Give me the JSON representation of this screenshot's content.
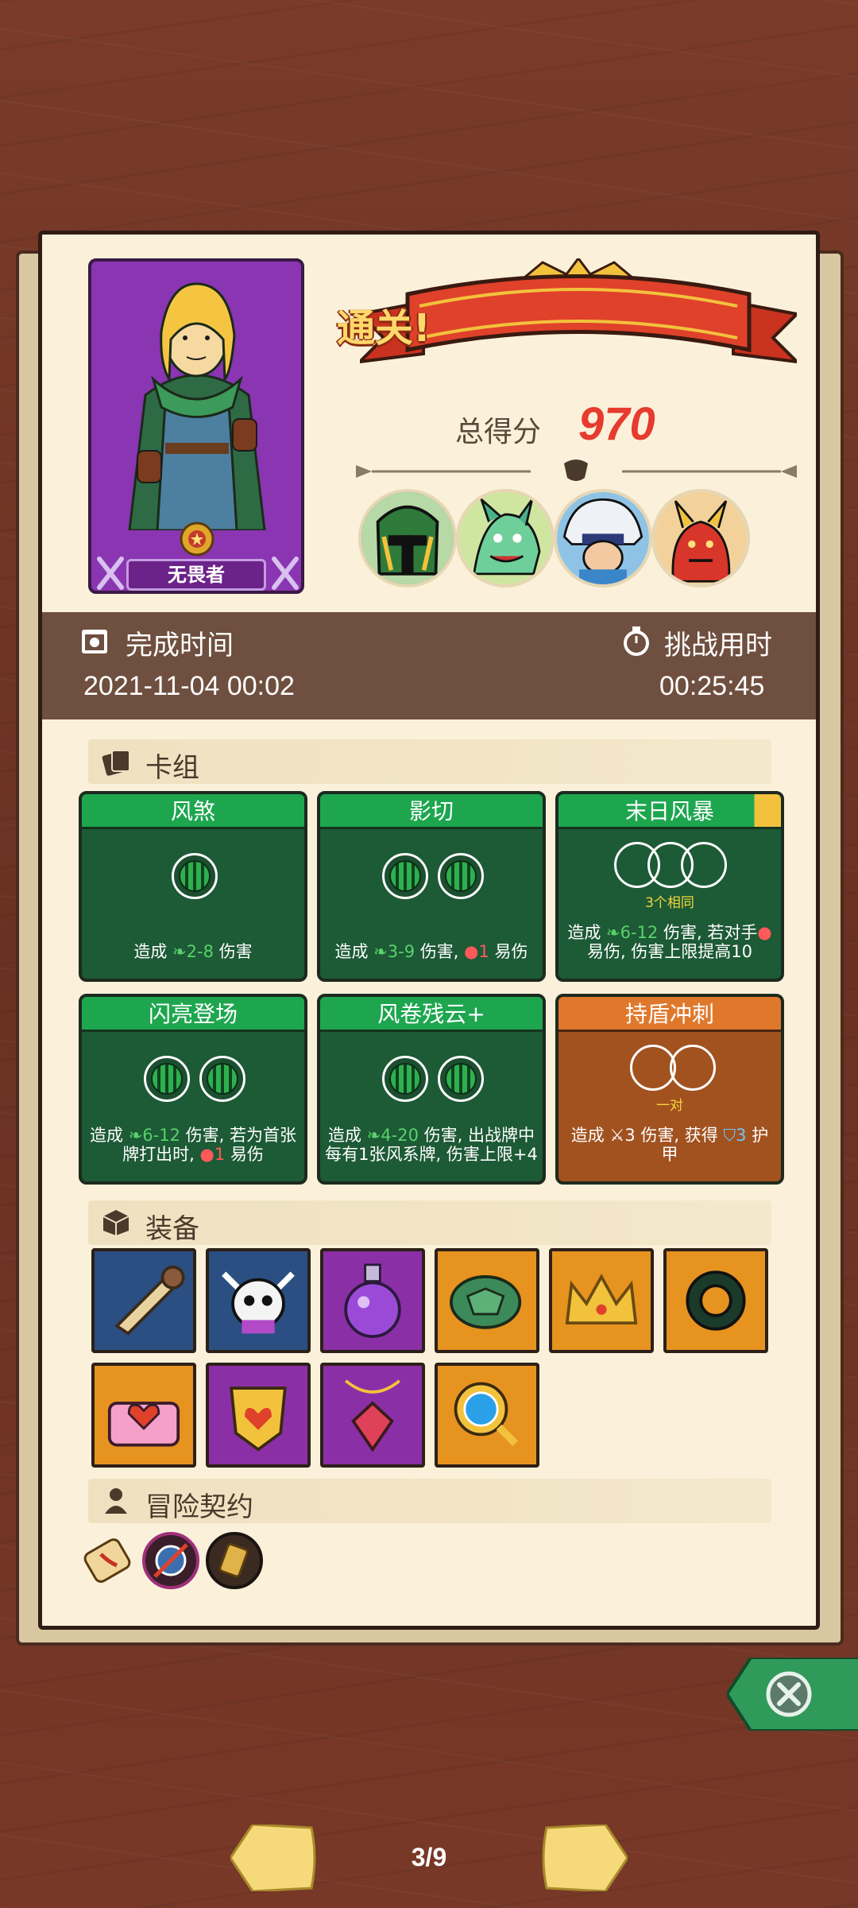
{
  "hero": {
    "title": "无畏者"
  },
  "result": {
    "banner": "通关!",
    "score_label": "总得分",
    "score_value": "970"
  },
  "bosses": [
    "green-helmet-boss-icon",
    "dragon-boss-icon",
    "yeti-boss-icon",
    "red-demon-boss-icon"
  ],
  "time": {
    "finish_label": "完成时间",
    "finish_value": "2021-11-04 00:02",
    "duration_label": "挑战用时",
    "duration_value": "00:25:45"
  },
  "deck": {
    "header": "卡组",
    "cards": [
      {
        "name": "风煞",
        "sub": "",
        "desc": [
          "造成 ",
          {
            "g": "2-8"
          },
          " 伤害"
        ]
      },
      {
        "name": "影切",
        "sub": "",
        "desc": [
          "造成 ",
          {
            "g": "3-9"
          },
          " 伤害, ",
          {
            "r": "1"
          },
          " 易伤"
        ]
      },
      {
        "name": "末日风暴",
        "sub": "3个相同",
        "desc": [
          "造成 ",
          {
            "g": "6-12"
          },
          " 伤害, 若对手",
          {
            "r": ""
          },
          "易伤, 伤害上限提高10"
        ]
      },
      {
        "name": "闪亮登场",
        "sub": "",
        "desc": [
          "造成 ",
          {
            "g": "6-12"
          },
          " 伤害, 若为首张牌打出时, ",
          {
            "r": "1"
          },
          " 易伤"
        ]
      },
      {
        "name": "风卷残云+",
        "sub": "",
        "desc": [
          "造成 ",
          {
            "g": "4-20"
          },
          " 伤害, 出战牌中每有1张风系牌, 伤害上限+4"
        ]
      },
      {
        "name": "持盾冲刺",
        "sub": "一对",
        "desc": [
          "造成 ",
          {
            "w": "3"
          },
          " 伤害, 获得 ",
          {
            "b": "3"
          },
          " 护甲"
        ]
      }
    ]
  },
  "equipment": {
    "header": "装备",
    "items": [
      {
        "icon": "horn-icon",
        "color": "#2b4f82"
      },
      {
        "icon": "skull-icon",
        "color": "#2b4f82"
      },
      {
        "icon": "potion-icon",
        "color": "#8b2fa6"
      },
      {
        "icon": "turtle-shell-icon",
        "color": "#e79320"
      },
      {
        "icon": "crown-icon",
        "color": "#e79320"
      },
      {
        "icon": "ring-icon",
        "color": "#e79320"
      },
      {
        "icon": "heart-box-icon",
        "color": "#e79320"
      },
      {
        "icon": "heart-shield-icon",
        "color": "#8b2fa6"
      },
      {
        "icon": "ruby-pendant-icon",
        "color": "#8b2fa6"
      },
      {
        "icon": "blue-gem-amulet-icon",
        "color": "#e79320"
      }
    ]
  },
  "contract": {
    "header": "冒险契约"
  },
  "nav": {
    "page": "3/9"
  }
}
